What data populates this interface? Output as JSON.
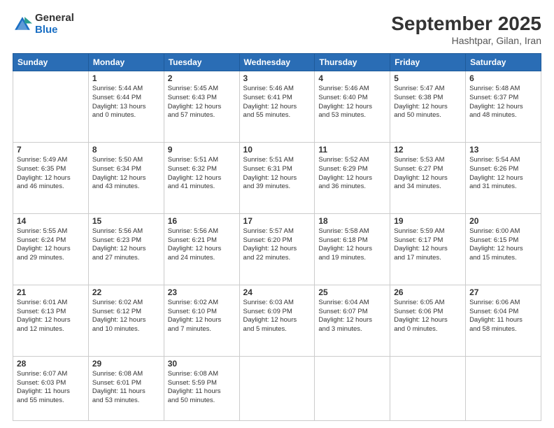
{
  "logo": {
    "general": "General",
    "blue": "Blue"
  },
  "title": "September 2025",
  "subtitle": "Hashtpar, Gilan, Iran",
  "weekdays": [
    "Sunday",
    "Monday",
    "Tuesday",
    "Wednesday",
    "Thursday",
    "Friday",
    "Saturday"
  ],
  "weeks": [
    [
      {
        "day": "",
        "info": ""
      },
      {
        "day": "1",
        "info": "Sunrise: 5:44 AM\nSunset: 6:44 PM\nDaylight: 13 hours\nand 0 minutes."
      },
      {
        "day": "2",
        "info": "Sunrise: 5:45 AM\nSunset: 6:43 PM\nDaylight: 12 hours\nand 57 minutes."
      },
      {
        "day": "3",
        "info": "Sunrise: 5:46 AM\nSunset: 6:41 PM\nDaylight: 12 hours\nand 55 minutes."
      },
      {
        "day": "4",
        "info": "Sunrise: 5:46 AM\nSunset: 6:40 PM\nDaylight: 12 hours\nand 53 minutes."
      },
      {
        "day": "5",
        "info": "Sunrise: 5:47 AM\nSunset: 6:38 PM\nDaylight: 12 hours\nand 50 minutes."
      },
      {
        "day": "6",
        "info": "Sunrise: 5:48 AM\nSunset: 6:37 PM\nDaylight: 12 hours\nand 48 minutes."
      }
    ],
    [
      {
        "day": "7",
        "info": "Sunrise: 5:49 AM\nSunset: 6:35 PM\nDaylight: 12 hours\nand 46 minutes."
      },
      {
        "day": "8",
        "info": "Sunrise: 5:50 AM\nSunset: 6:34 PM\nDaylight: 12 hours\nand 43 minutes."
      },
      {
        "day": "9",
        "info": "Sunrise: 5:51 AM\nSunset: 6:32 PM\nDaylight: 12 hours\nand 41 minutes."
      },
      {
        "day": "10",
        "info": "Sunrise: 5:51 AM\nSunset: 6:31 PM\nDaylight: 12 hours\nand 39 minutes."
      },
      {
        "day": "11",
        "info": "Sunrise: 5:52 AM\nSunset: 6:29 PM\nDaylight: 12 hours\nand 36 minutes."
      },
      {
        "day": "12",
        "info": "Sunrise: 5:53 AM\nSunset: 6:27 PM\nDaylight: 12 hours\nand 34 minutes."
      },
      {
        "day": "13",
        "info": "Sunrise: 5:54 AM\nSunset: 6:26 PM\nDaylight: 12 hours\nand 31 minutes."
      }
    ],
    [
      {
        "day": "14",
        "info": "Sunrise: 5:55 AM\nSunset: 6:24 PM\nDaylight: 12 hours\nand 29 minutes."
      },
      {
        "day": "15",
        "info": "Sunrise: 5:56 AM\nSunset: 6:23 PM\nDaylight: 12 hours\nand 27 minutes."
      },
      {
        "day": "16",
        "info": "Sunrise: 5:56 AM\nSunset: 6:21 PM\nDaylight: 12 hours\nand 24 minutes."
      },
      {
        "day": "17",
        "info": "Sunrise: 5:57 AM\nSunset: 6:20 PM\nDaylight: 12 hours\nand 22 minutes."
      },
      {
        "day": "18",
        "info": "Sunrise: 5:58 AM\nSunset: 6:18 PM\nDaylight: 12 hours\nand 19 minutes."
      },
      {
        "day": "19",
        "info": "Sunrise: 5:59 AM\nSunset: 6:17 PM\nDaylight: 12 hours\nand 17 minutes."
      },
      {
        "day": "20",
        "info": "Sunrise: 6:00 AM\nSunset: 6:15 PM\nDaylight: 12 hours\nand 15 minutes."
      }
    ],
    [
      {
        "day": "21",
        "info": "Sunrise: 6:01 AM\nSunset: 6:13 PM\nDaylight: 12 hours\nand 12 minutes."
      },
      {
        "day": "22",
        "info": "Sunrise: 6:02 AM\nSunset: 6:12 PM\nDaylight: 12 hours\nand 10 minutes."
      },
      {
        "day": "23",
        "info": "Sunrise: 6:02 AM\nSunset: 6:10 PM\nDaylight: 12 hours\nand 7 minutes."
      },
      {
        "day": "24",
        "info": "Sunrise: 6:03 AM\nSunset: 6:09 PM\nDaylight: 12 hours\nand 5 minutes."
      },
      {
        "day": "25",
        "info": "Sunrise: 6:04 AM\nSunset: 6:07 PM\nDaylight: 12 hours\nand 3 minutes."
      },
      {
        "day": "26",
        "info": "Sunrise: 6:05 AM\nSunset: 6:06 PM\nDaylight: 12 hours\nand 0 minutes."
      },
      {
        "day": "27",
        "info": "Sunrise: 6:06 AM\nSunset: 6:04 PM\nDaylight: 11 hours\nand 58 minutes."
      }
    ],
    [
      {
        "day": "28",
        "info": "Sunrise: 6:07 AM\nSunset: 6:03 PM\nDaylight: 11 hours\nand 55 minutes."
      },
      {
        "day": "29",
        "info": "Sunrise: 6:08 AM\nSunset: 6:01 PM\nDaylight: 11 hours\nand 53 minutes."
      },
      {
        "day": "30",
        "info": "Sunrise: 6:08 AM\nSunset: 5:59 PM\nDaylight: 11 hours\nand 50 minutes."
      },
      {
        "day": "",
        "info": ""
      },
      {
        "day": "",
        "info": ""
      },
      {
        "day": "",
        "info": ""
      },
      {
        "day": "",
        "info": ""
      }
    ]
  ]
}
